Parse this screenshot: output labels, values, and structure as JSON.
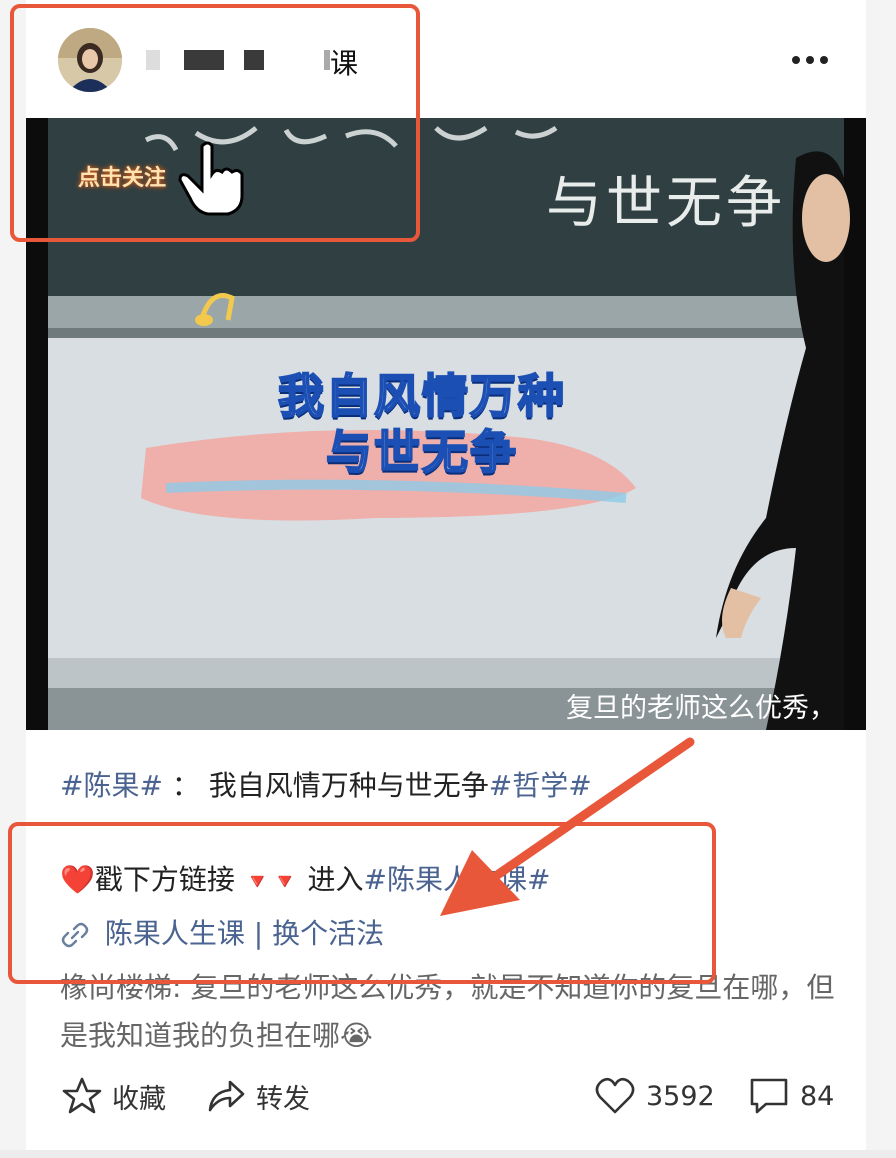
{
  "header": {
    "username_visible_suffix": "课",
    "more_label": "•••"
  },
  "video": {
    "follow_overlay": "点击关注",
    "caption_line1": "我自风情万种",
    "caption_line2": "与世无争",
    "subtitle": "复旦的老师这么优秀，",
    "chalk_text": "与世无争"
  },
  "post": {
    "tag1": "#陈果#",
    "separator": "：",
    "text": "我自风情万种与世无争",
    "tag2": "#哲学#"
  },
  "promo": {
    "heart": "❤️",
    "text1": "戳下方链接",
    "arrows": "🔻🔻",
    "text2": "进入",
    "tag": "#陈果人生课#"
  },
  "link": {
    "label": "陈果人生课 | 换个活法"
  },
  "comment": {
    "author": "橡尚楼梯",
    "text": ": 复旦的老师这么优秀，就是不知道你的复旦在哪，但是我知道我的负担在哪😭"
  },
  "actions": {
    "favorite_label": "收藏",
    "share_label": "转发",
    "likes": "3592",
    "comments": "84"
  },
  "colors": {
    "accent_link": "#4a6390",
    "annotation": "#e8573a"
  }
}
